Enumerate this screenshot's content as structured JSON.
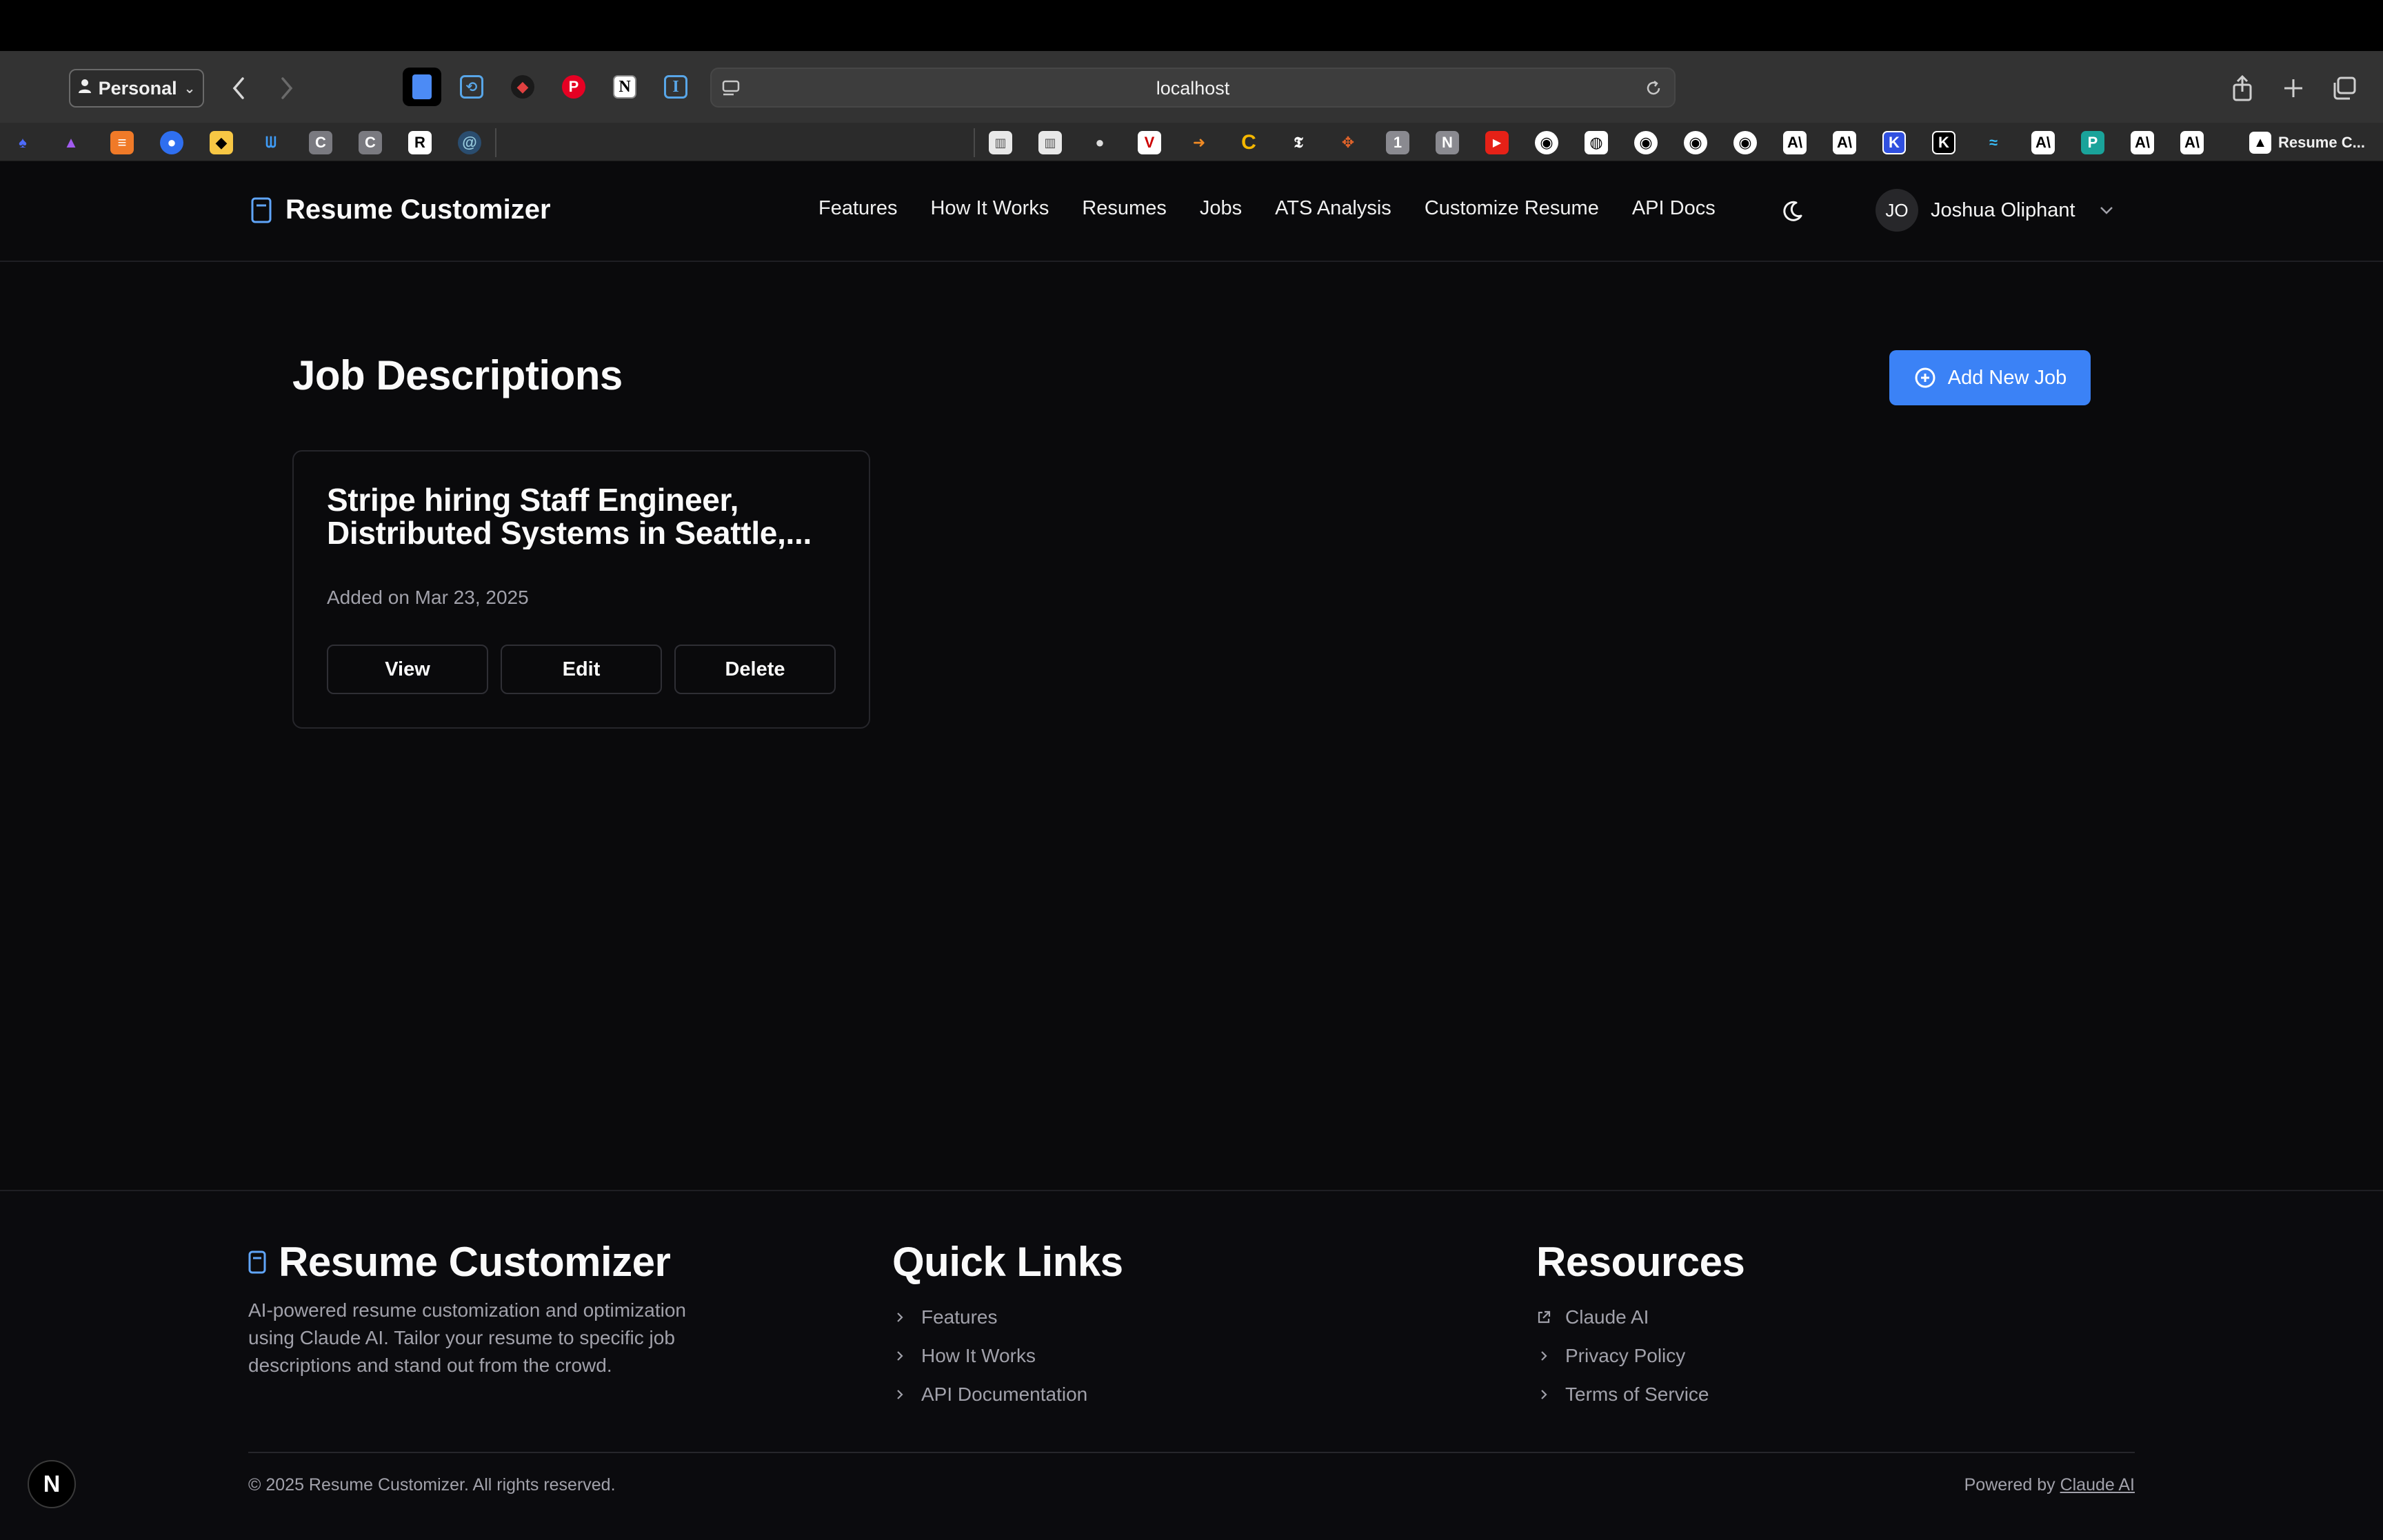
{
  "browser": {
    "profile_label": "Personal",
    "address": "localhost",
    "active_tab_title": "Resume C..."
  },
  "app": {
    "brand": "Resume Customizer",
    "nav": [
      "Features",
      "How It Works",
      "Resumes",
      "Jobs",
      "ATS Analysis",
      "Customize Resume",
      "API Docs"
    ],
    "user": {
      "initials": "JO",
      "name": "Joshua Oliphant"
    }
  },
  "main": {
    "title": "Job Descriptions",
    "add_button": "Add New Job",
    "jobs": [
      {
        "title": "Stripe hiring Staff Engineer, Distributed Systems in Seattle,...",
        "added": "Added on Mar 23, 2025",
        "actions": [
          "View",
          "Edit",
          "Delete"
        ]
      }
    ]
  },
  "footer": {
    "brand": "Resume Customizer",
    "description": "AI-powered resume customization and optimization using Claude AI. Tailor your resume to specific job descriptions and stand out from the crowd.",
    "quick_links_heading": "Quick Links",
    "quick_links": [
      "Features",
      "How It Works",
      "API Documentation"
    ],
    "resources_heading": "Resources",
    "resources": [
      "Claude AI",
      "Privacy Policy",
      "Terms of Service"
    ],
    "copyright": "© 2025 Resume Customizer. All rights reserved.",
    "powered_prefix": "Powered by ",
    "powered_link": "Claude AI"
  },
  "colors": {
    "background": "#0a0a0c",
    "accent": "#3b82f6",
    "muted_text": "#a1a1aa",
    "border": "#26262b"
  },
  "dev_badge": "N"
}
